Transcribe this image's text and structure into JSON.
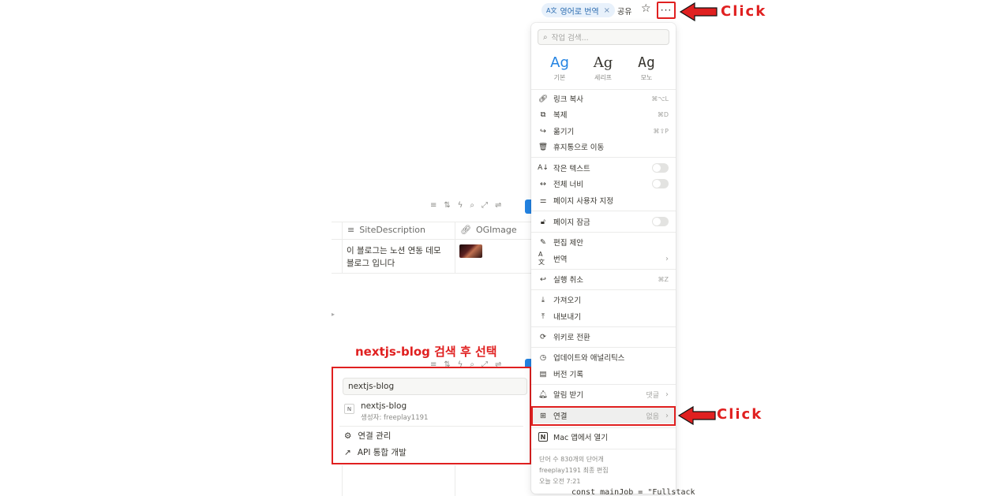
{
  "topbar": {
    "translate_chip": "영어로 번역",
    "translate_chip_icon": "translate-icon",
    "share": "공유",
    "more": "···"
  },
  "annotations": {
    "click_top": "Click",
    "click_bottom": "Click",
    "left_title": "nextjs-blog 검색 후 선택",
    "accent": "#e02020"
  },
  "table": {
    "columns": [
      "SiteDescription",
      "OGImage"
    ],
    "cell_text": "이 블로그는 노션 연동 데모 블로그 입니다"
  },
  "connect_popup": {
    "search_value": "nextjs-blog",
    "result_title": "nextjs-blog",
    "result_sub": "생성자: freeplay1191",
    "manage": "연결 관리",
    "develop": "API 통합 개발"
  },
  "menu": {
    "search_placeholder": "작업 검색...",
    "fonts": [
      {
        "ag": "Ag",
        "label": "기본"
      },
      {
        "ag": "Ag",
        "label": "세리프"
      },
      {
        "ag": "Ag",
        "label": "모노"
      }
    ],
    "items": {
      "copy_link": {
        "label": "링크 복사",
        "shortcut": "⌘⌥L"
      },
      "duplicate": {
        "label": "복제",
        "shortcut": "⌘D"
      },
      "move": {
        "label": "옮기기",
        "shortcut": "⌘⇧P"
      },
      "trash": {
        "label": "휴지통으로 이동"
      },
      "small_text": {
        "label": "작은 텍스트"
      },
      "full_width": {
        "label": "전체 너비"
      },
      "customize": {
        "label": "페이지 사용자 지정"
      },
      "lock": {
        "label": "페이지 잠금"
      },
      "suggest": {
        "label": "편집 제안"
      },
      "translate": {
        "label": "번역"
      },
      "undo": {
        "label": "실행 취소",
        "shortcut": "⌘Z"
      },
      "import": {
        "label": "가져오기"
      },
      "export": {
        "label": "내보내기"
      },
      "wiki": {
        "label": "위키로 전환"
      },
      "updates": {
        "label": "업데이트와 애널리틱스"
      },
      "history": {
        "label": "버전 기록"
      },
      "notify": {
        "label": "알림 받기",
        "value": "댓글"
      },
      "connect": {
        "label": "연결",
        "value": "없음"
      },
      "mac": {
        "label": "Mac 앱에서 열기"
      }
    },
    "footer": {
      "words": "단어 수 830개의 단어개",
      "edited_by": "freeplay1191 최종 편집",
      "time": "오늘 오전 7:21"
    }
  },
  "bottom_code": "const mainJob = \"Fullstack"
}
